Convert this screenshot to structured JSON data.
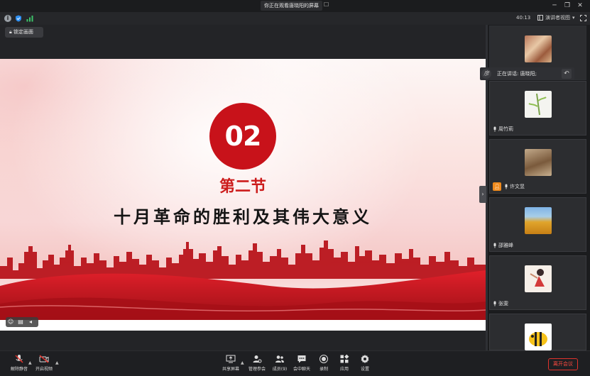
{
  "titlebar": {
    "title": "你正在观看唐晓阳的屏幕",
    "close_mini": "☐",
    "minimize": "─",
    "restore": "❐",
    "close": "✕"
  },
  "status": {
    "icons": [
      "info-icon",
      "shield-icon",
      "signal-icon"
    ],
    "timer": "40:13",
    "view_mode": "演讲者视图",
    "accent": "#2f8ff0"
  },
  "lock_button": {
    "label": "锁定画面"
  },
  "slide": {
    "number": "02",
    "section": "第二节",
    "title": "十月革命的胜利及其伟大意义",
    "brand_red": "#c8121a"
  },
  "speaking": {
    "text": "正在讲话: 唐晓阳;"
  },
  "participants": [
    {
      "name": "",
      "avatar": "painting"
    },
    {
      "name": "周竹莉",
      "avatar": "bamboo"
    },
    {
      "name": "许文昱",
      "avatar": "cat",
      "host": true
    },
    {
      "name": "邵雅峰",
      "avatar": "landscape"
    },
    {
      "name": "张雯",
      "avatar": "figure"
    },
    {
      "name": "",
      "avatar": "bee"
    }
  ],
  "toolbar": {
    "mute": "解除静音",
    "video": "开启视频",
    "share": "共享屏幕",
    "manage": "管理参会",
    "members": "成员(9)",
    "chat": "会中聊天",
    "record": "录制",
    "apps": "应用",
    "settings": "设置",
    "leave": "离开会议"
  }
}
